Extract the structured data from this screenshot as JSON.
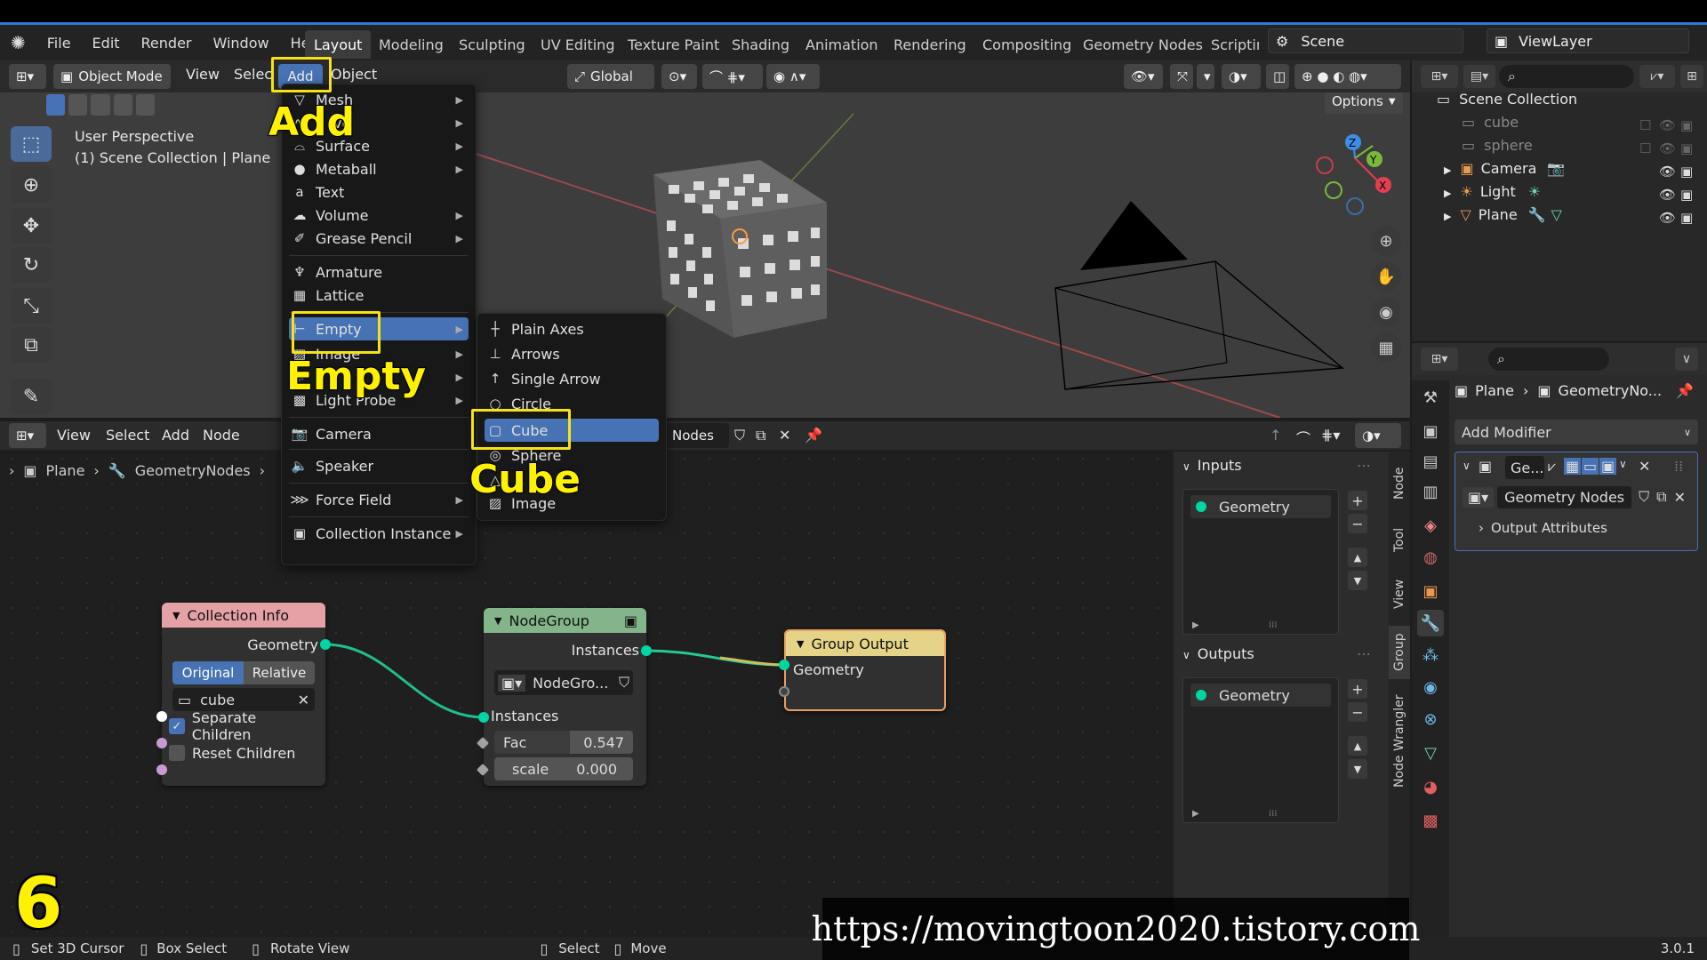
{
  "menubar": {
    "items": [
      "File",
      "Edit",
      "Render",
      "Window",
      "Help"
    ],
    "workspaces": [
      "Layout",
      "Modeling",
      "Sculpting",
      "UV Editing",
      "Texture Paint",
      "Shading",
      "Animation",
      "Rendering",
      "Compositing",
      "Geometry Nodes",
      "Scriptin"
    ],
    "scene": "Scene",
    "view_layer": "ViewLayer"
  },
  "viewport": {
    "mode": "Object Mode",
    "menus": [
      "View",
      "Selec",
      "Add",
      "Object"
    ],
    "transform": "Global",
    "options": "Options",
    "perspective": "User Perspective",
    "context": "(1) Scene Collection | Plane"
  },
  "add_menu": {
    "items": [
      {
        "label": "Mesh",
        "sub": true
      },
      {
        "label": "ve",
        "sub": true
      },
      {
        "label": "Surface",
        "sub": true
      },
      {
        "label": "Metaball",
        "sub": true
      },
      {
        "label": "Text",
        "sub": false
      },
      {
        "label": "Volume",
        "sub": true
      },
      {
        "label": "Grease Pencil",
        "sub": true
      },
      {
        "label": "Armature",
        "sub": false
      },
      {
        "label": "Lattice",
        "sub": false
      },
      {
        "label": "Empty",
        "sub": true
      },
      {
        "label": "Image",
        "sub": true
      },
      {
        "label": "",
        "sub": true
      },
      {
        "label": "Light Probe",
        "sub": true
      },
      {
        "label": "Camera",
        "sub": false
      },
      {
        "label": "Speaker",
        "sub": false
      },
      {
        "label": "Force Field",
        "sub": true
      },
      {
        "label": "Collection Instance",
        "sub": true
      }
    ]
  },
  "empty_menu": {
    "items": [
      "Plain Axes",
      "Arrows",
      "Single Arrow",
      "Circle",
      "Cube",
      "Sphere",
      "",
      "Image"
    ]
  },
  "annotations": {
    "add": "Add",
    "empty": "Empty",
    "cube": "Cube",
    "step": "6"
  },
  "node_editor": {
    "menus": [
      "View",
      "Select",
      "Add",
      "Node"
    ],
    "tree_name": "Nodes",
    "breadcrumb": [
      "Plane",
      "GeometryNodes"
    ]
  },
  "nodes": {
    "collection_info": {
      "title": "Collection Info",
      "out": "Geometry",
      "original": "Original",
      "relative": "Relative",
      "collection": "cube",
      "separate": "Separate Children",
      "reset": "Reset Children"
    },
    "nodegroup": {
      "title": "NodeGroup",
      "out": "Instances",
      "group": "NodeGro...",
      "in": "Instances",
      "fac_label": "Fac",
      "fac_value": "0.547",
      "scale_label": "scale",
      "scale_value": "0.000"
    },
    "group_output": {
      "title": "Group Output",
      "in": "Geometry"
    }
  },
  "npanel": {
    "inputs": "Inputs",
    "outputs": "Outputs",
    "input_item": "Geometry",
    "output_item": "Geometry",
    "tabs": [
      "Node",
      "Tool",
      "View",
      "Group",
      "Node Wrangler"
    ]
  },
  "outliner": {
    "root": "Scene Collection",
    "items": [
      "cube",
      "sphere",
      "Camera",
      "Light",
      "Plane"
    ]
  },
  "properties": {
    "breadcrumb_obj": "Plane",
    "breadcrumb_mod": "GeometryNo...",
    "add_modifier": "Add Modifier",
    "mod_short": "Ge...",
    "mod_name": "Geometry Nodes",
    "output_attrs": "Output Attributes"
  },
  "status": {
    "items": [
      "Set 3D Cursor",
      "Box Select",
      "Rotate View",
      "Select",
      "Move"
    ],
    "version": "3.0.1"
  },
  "watermark": "https://movingtoon2020.tistory.com",
  "colors": {
    "accent": "#4772b3",
    "highlight": "#f5e312",
    "socket_geometry": "#00d6a3",
    "socket_float": "#a1a1a1"
  }
}
